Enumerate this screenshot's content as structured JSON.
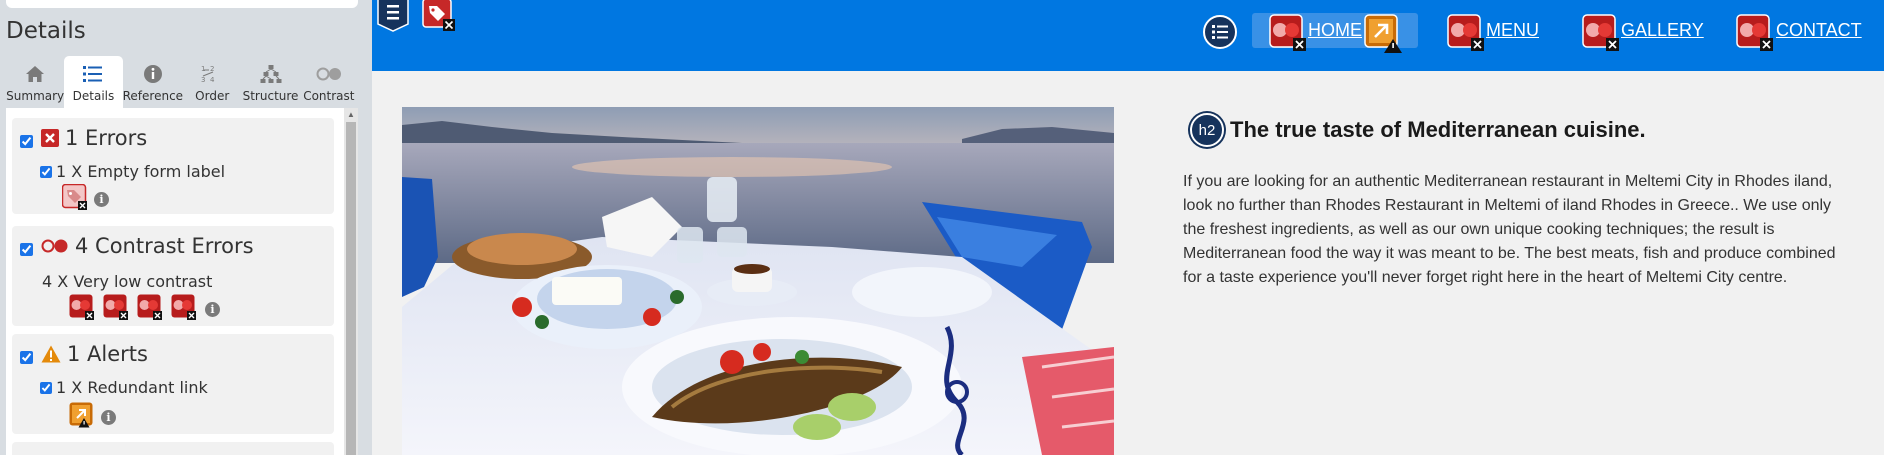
{
  "panel": {
    "title": "Details",
    "tabs": [
      {
        "label": "Summary",
        "icon": "home-icon"
      },
      {
        "label": "Details",
        "icon": "list-icon",
        "active": true
      },
      {
        "label": "Reference",
        "icon": "info-icon"
      },
      {
        "label": "Order",
        "icon": "order-icon"
      },
      {
        "label": "Structure",
        "icon": "structure-icon"
      },
      {
        "label": "Contrast",
        "icon": "contrast-icon"
      }
    ],
    "errors": {
      "heading": "1 Errors",
      "item": "1 X Empty form label"
    },
    "contrast": {
      "heading": "4 Contrast Errors",
      "item": "4 X Very low contrast"
    },
    "alerts": {
      "heading": "1 Alerts",
      "item": "1 X Redundant link"
    },
    "colors": {
      "error": "#c62828",
      "alert": "#e48a0b",
      "accent": "#1a73e8"
    }
  },
  "site": {
    "nav": {
      "home": "HOME",
      "menu": "MENU",
      "gallery": "GALLERY",
      "contact": "CONTACT",
      "bg": "#0077e1"
    },
    "heading_badge": "h2",
    "heading": "The true taste of Mediterranean cuisine.",
    "paragraph": "If you are looking for an authentic Mediterranean restaurant in Meltemi City in Rhodes iland, look no further than Rhodes Restaurant in Meltemi of iland Rhodes in Greece.. We use only the freshest ingredients, as well as our own unique cooking techniques; the result is Mediterranean food the way it was meant to be. The best meats, fish and produce combined for a taste experience you'll never forget right here in the heart of Meltemi City centre."
  }
}
